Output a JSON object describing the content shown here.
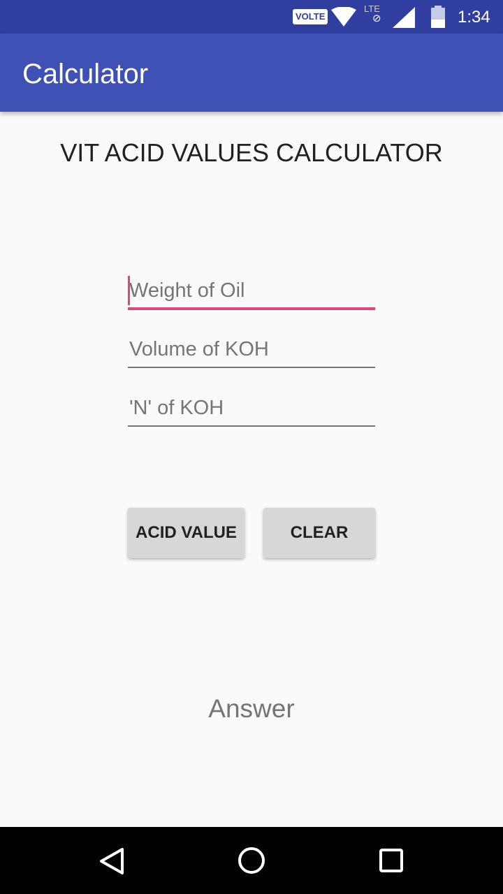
{
  "status_bar": {
    "volte_label": "VOLTE",
    "lte_label": "LTE",
    "time": "1:34",
    "icons": [
      "wifi-icon",
      "lte-icon",
      "signal-icon",
      "battery-icon"
    ]
  },
  "app_bar": {
    "title": "Calculator",
    "color": "#3f51b5",
    "status_color": "#303f9f"
  },
  "main": {
    "heading": "VIT ACID VALUES CALCULATOR",
    "fields": [
      {
        "placeholder": "Weight of Oil",
        "value": "",
        "focused": true
      },
      {
        "placeholder": "Volume of KOH",
        "value": ""
      },
      {
        "placeholder": "'N' of KOH",
        "value": ""
      }
    ],
    "buttons": {
      "acid_value_label": "ACID VALUE",
      "clear_label": "CLEAR"
    },
    "answer": "Answer",
    "accent_color": "#e0457b"
  },
  "nav_bar": {
    "icons": [
      "back-icon",
      "home-icon",
      "recents-icon"
    ]
  }
}
